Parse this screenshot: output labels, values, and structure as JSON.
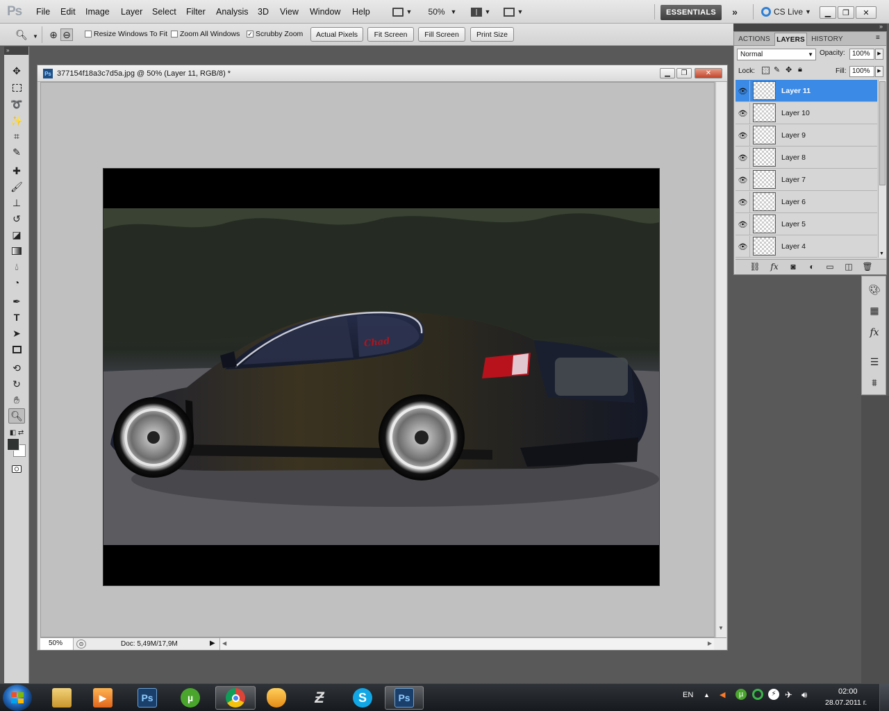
{
  "app": {
    "logo": "Ps",
    "menu": [
      "File",
      "Edit",
      "Image",
      "Layer",
      "Select",
      "Filter",
      "Analysis",
      "3D",
      "View",
      "Window",
      "Help"
    ],
    "zoom_display": "50%",
    "workspace": "ESSENTIALS",
    "cs_live": "CS Live"
  },
  "options_bar": {
    "resize_windows": "Resize Windows To Fit",
    "zoom_all": "Zoom All Windows",
    "scrubby": "Scrubby Zoom",
    "scrubby_checked": "✓",
    "actual_pixels": "Actual Pixels",
    "fit_screen": "Fit Screen",
    "fill_screen": "Fill Screen",
    "print_size": "Print Size"
  },
  "document": {
    "title": "377154f18a3c7d5a.jpg @ 50% (Layer 11, RGB/8) *",
    "zoom": "50%",
    "doc_size": "Doc: 5,49M/17,9M",
    "watermark": "Chad"
  },
  "panel": {
    "tabs": [
      "ACTIONS",
      "LAYERS",
      "HISTORY"
    ],
    "active_tab": "LAYERS",
    "blend_mode": "Normal",
    "opacity_label": "Opacity:",
    "opacity_value": "100%",
    "lock_label": "Lock:",
    "fill_label": "Fill:",
    "fill_value": "100%",
    "layers": [
      {
        "name": "Layer 11",
        "selected": true
      },
      {
        "name": "Layer 10",
        "selected": false
      },
      {
        "name": "Layer 9",
        "selected": false
      },
      {
        "name": "Layer 8",
        "selected": false
      },
      {
        "name": "Layer 7",
        "selected": false
      },
      {
        "name": "Layer 6",
        "selected": false
      },
      {
        "name": "Layer 5",
        "selected": false
      },
      {
        "name": "Layer 4",
        "selected": false
      }
    ]
  },
  "taskbar": {
    "apps": [
      "explorer",
      "media-player",
      "photoshop",
      "utorrent",
      "chrome",
      "fruity-loops",
      "nfs",
      "skype",
      "photoshop"
    ],
    "photoshop_label": "Ps",
    "utorrent_label": "µ",
    "skype_label": "S",
    "language": "EN",
    "time": "02:00",
    "date": "28.07.2011 г."
  }
}
